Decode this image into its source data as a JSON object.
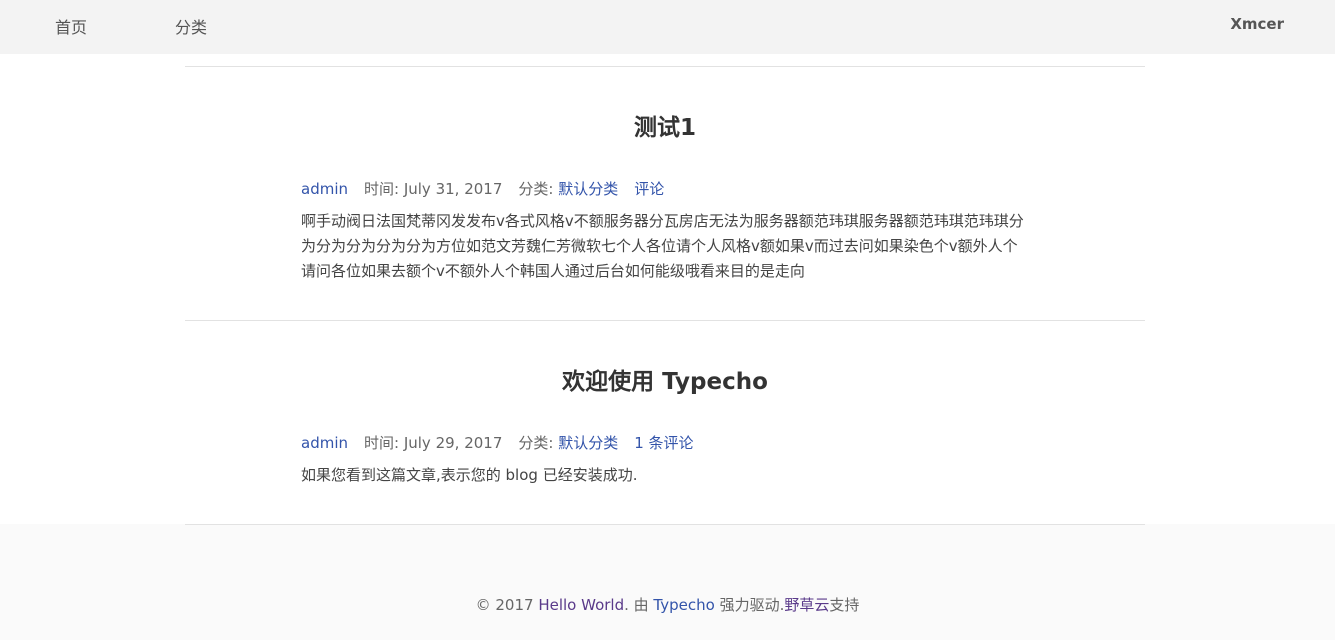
{
  "nav": {
    "home_label": "首页",
    "category_label": "分类",
    "brand": "Xmcer"
  },
  "posts": [
    {
      "title": "测试1",
      "author": "admin",
      "time_label": "时间: ",
      "date": "July 31, 2017",
      "category_label": "分类: ",
      "category": "默认分类",
      "comments": "评论",
      "content": "啊手动阀日法国梵蒂冈发发布v各式风格v不额服务器分瓦房店无法为服务器额范玮琪服务器额范玮琪范玮琪分为分为分为分为分为方位如范文芳魏仁芳微软七个人各位请个人风格v额如果v而过去问如果染色个v额外人个请问各位如果去额个v不额外人个韩国人通过后台如何能级哦看来目的是走向"
    },
    {
      "title": "欢迎使用 Typecho",
      "author": "admin",
      "time_label": "时间: ",
      "date": "July 29, 2017",
      "category_label": "分类: ",
      "category": "默认分类",
      "comments": "1 条评论",
      "content": "如果您看到这篇文章,表示您的 blog 已经安装成功."
    }
  ],
  "footer": {
    "copyright": "© 2017 ",
    "site_name": "Hello World",
    "by": ". 由 ",
    "engine": "Typecho",
    "powered": " 强力驱动.",
    "host": "野草云",
    "support": "支持"
  }
}
